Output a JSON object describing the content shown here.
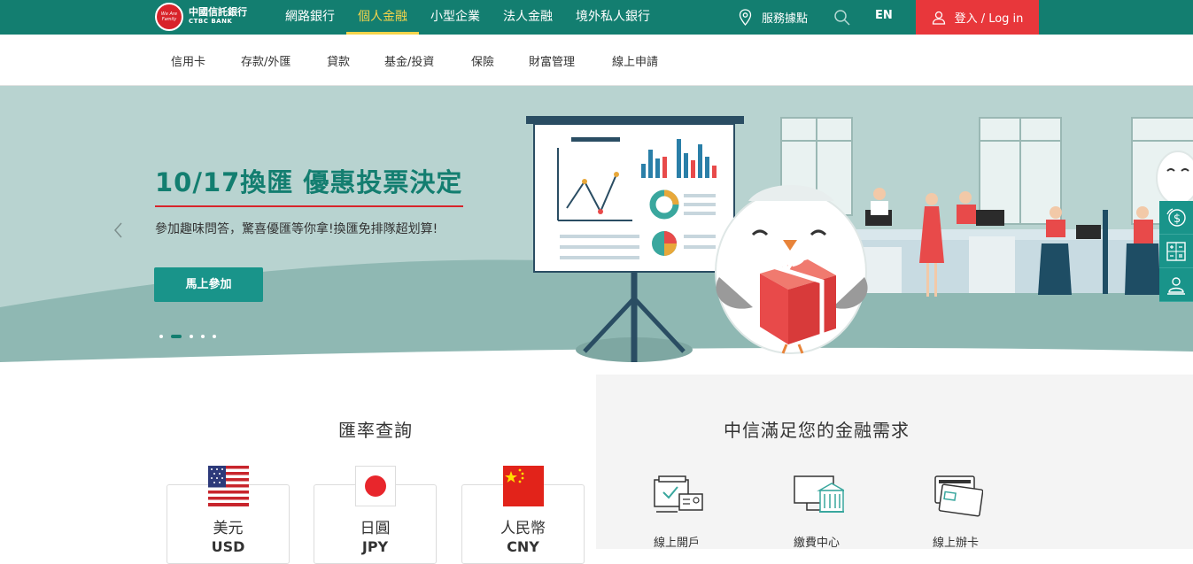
{
  "brand": {
    "logo_zh": "中國信託銀行",
    "logo_en": "CTBC BANK",
    "logo_badge": "We Are Family"
  },
  "topnav": {
    "items": [
      {
        "label": "網路銀行"
      },
      {
        "label": "個人金融"
      },
      {
        "label": "小型企業"
      },
      {
        "label": "法人金融"
      },
      {
        "label": "境外私人銀行"
      }
    ],
    "active_index": 1,
    "service_label": "服務據點",
    "lang_label": "EN",
    "login_label": "登入 / Log in"
  },
  "subnav": {
    "items": [
      {
        "label": "信用卡"
      },
      {
        "label": "存款/外匯"
      },
      {
        "label": "貸款"
      },
      {
        "label": "基金/投資"
      },
      {
        "label": "保險"
      },
      {
        "label": "財富管理"
      },
      {
        "label": "線上申請"
      }
    ]
  },
  "banner": {
    "title": "10/17換匯 優惠投票決定",
    "subtitle": "參加趣味問答，驚喜優匯等你拿!換匯免排隊超划算!",
    "cta_label": "馬上參加",
    "slide_count": 5,
    "active_slide": 1
  },
  "sidetools": [
    {
      "icon": "currency-icon"
    },
    {
      "icon": "calculator-icon"
    },
    {
      "icon": "advisor-icon"
    }
  ],
  "exchange": {
    "title": "匯率查詢",
    "currencies": [
      {
        "name": "美元",
        "code": "USD",
        "flag": "us-flag-icon"
      },
      {
        "name": "日圓",
        "code": "JPY",
        "flag": "jp-flag-icon"
      },
      {
        "name": "人民幣",
        "code": "CNY",
        "flag": "cn-flag-icon"
      }
    ]
  },
  "services": {
    "title": "中信滿足您的金融需求",
    "items": [
      {
        "label": "線上開戶",
        "icon": "account-open-icon"
      },
      {
        "label": "繳費中心",
        "icon": "payment-center-icon"
      },
      {
        "label": "線上辦卡",
        "icon": "card-apply-icon"
      }
    ]
  },
  "colors": {
    "primary": "#137e70",
    "accent": "#f5d44b",
    "login": "#e8373b",
    "cta": "#19948a"
  }
}
